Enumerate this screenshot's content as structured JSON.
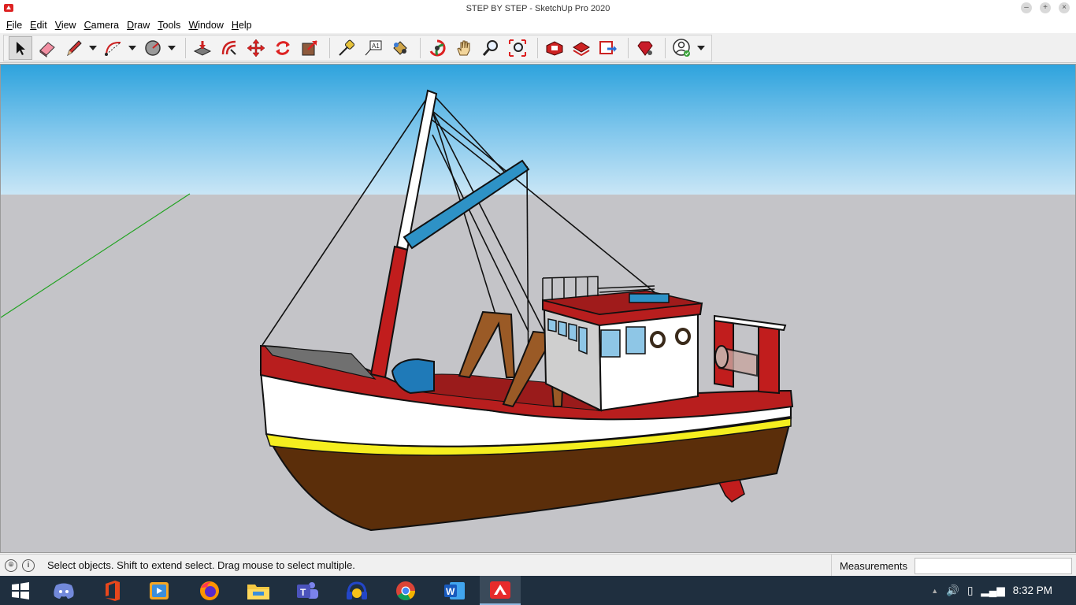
{
  "window": {
    "title": "STEP BY STEP - SketchUp Pro 2020"
  },
  "menu": [
    "File",
    "Edit",
    "View",
    "Camera",
    "Draw",
    "Tools",
    "Window",
    "Help"
  ],
  "toolbar": {
    "tools": [
      {
        "name": "select-tool-icon",
        "active": true
      },
      {
        "name": "eraser-tool-icon"
      },
      {
        "name": "pencil-line-tool-icon",
        "dropdown": true
      },
      {
        "name": "arc-tool-icon",
        "dropdown": true
      },
      {
        "name": "circle-shape-tool-icon",
        "dropdown": true
      },
      {
        "name": "push-pull-tool-icon"
      },
      {
        "name": "offset-tool-icon"
      },
      {
        "name": "move-tool-icon"
      },
      {
        "name": "rotate-tool-icon"
      },
      {
        "name": "scale-tool-icon"
      },
      {
        "name": "tape-measure-tool-icon"
      },
      {
        "name": "text-tool-icon"
      },
      {
        "name": "paint-bucket-tool-icon"
      },
      {
        "name": "orbit-tool-icon"
      },
      {
        "name": "pan-tool-icon"
      },
      {
        "name": "zoom-tool-icon"
      },
      {
        "name": "zoom-extents-tool-icon"
      },
      {
        "name": "3d-warehouse-icon"
      },
      {
        "name": "extension-warehouse-icon"
      },
      {
        "name": "send-to-layout-icon"
      },
      {
        "name": "extension-manager-icon"
      },
      {
        "name": "account-icon",
        "dropdown": true
      }
    ]
  },
  "status": {
    "message": "Select objects. Shift to extend select. Drag mouse to select multiple.",
    "measurements_label": "Measurements",
    "measurements_value": ""
  },
  "taskbar": {
    "apps": [
      "windows-start-icon",
      "discord-icon",
      "office-icon",
      "media-player-icon",
      "firefox-icon",
      "file-explorer-icon",
      "teams-icon",
      "headphones-app-icon",
      "chrome-icon",
      "word-icon",
      "sketchup-icon"
    ],
    "active_app": "sketchup-icon",
    "clock": "8:32 PM"
  }
}
